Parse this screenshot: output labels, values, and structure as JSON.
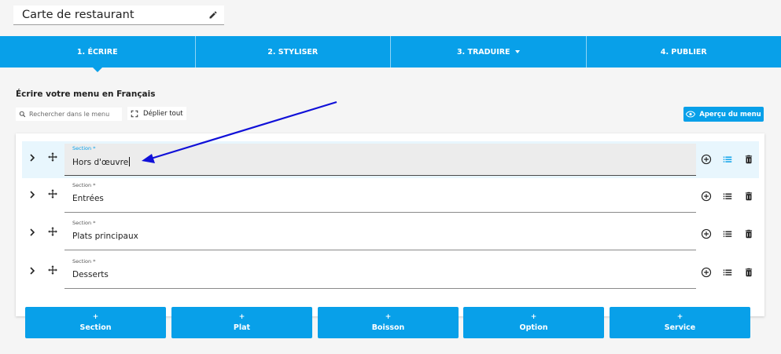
{
  "header": {
    "title": "Carte de restaurant"
  },
  "tabs": [
    {
      "label": "1. ÉCRIRE",
      "active": true
    },
    {
      "label": "2. STYLISER"
    },
    {
      "label": "3. TRADUIRE",
      "dropdown": true
    },
    {
      "label": "4. PUBLIER"
    }
  ],
  "main": {
    "heading": "Écrire votre menu en Français",
    "search_placeholder": "Rechercher dans le menu",
    "expand_all_label": "Déplier tout",
    "preview_label": "Aperçu du menu",
    "field_label": "Section *",
    "sections": [
      {
        "name": "Hors d'œuvre",
        "focused": true
      },
      {
        "name": "Entrées"
      },
      {
        "name": "Plats principaux"
      },
      {
        "name": "Desserts"
      }
    ]
  },
  "add_buttons": [
    {
      "plus": "+",
      "label": "Section"
    },
    {
      "plus": "+",
      "label": "Plat"
    },
    {
      "plus": "+",
      "label": "Boisson"
    },
    {
      "plus": "+",
      "label": "Option"
    },
    {
      "plus": "+",
      "label": "Service"
    }
  ],
  "colors": {
    "accent": "#08a0e9",
    "annotation": "#1010d8",
    "background": "#f5f5f5"
  },
  "icons": {
    "edit": "pencil-icon",
    "search": "search-icon",
    "expand": "expand-corners-icon",
    "preview": "eye-icon",
    "collapse": "chevron-right-icon",
    "drag": "move-icon",
    "add": "add-circle-icon",
    "list": "list-icon",
    "delete": "trash-icon"
  }
}
